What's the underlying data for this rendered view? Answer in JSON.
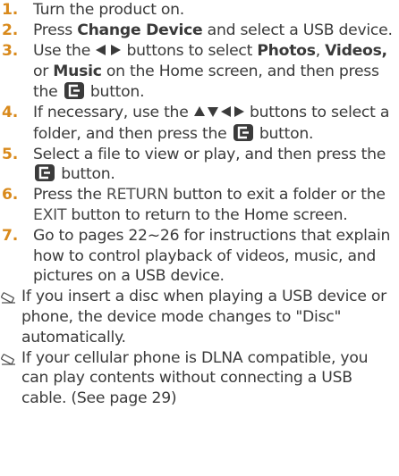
{
  "steps": [
    {
      "num": "1.",
      "text": "Turn the product on."
    },
    {
      "num": "2.",
      "a": "Press ",
      "b1": "Change Device",
      "c": " and select a USB device."
    },
    {
      "num": "3.",
      "a": "Use the ",
      "b": " buttons to select ",
      "p": "Photos",
      "sep1": ", ",
      "v": "Videos,",
      "sep2": " or ",
      "m": "Music",
      "c": " on the Home screen, and then press the ",
      "d": " button."
    },
    {
      "num": "4.",
      "a": "If necessary, use the ",
      "b": " buttons to select a folder, and then press the ",
      "c": " button."
    },
    {
      "num": "5.",
      "a": "Select a file to view or play, and then press the ",
      "b": " button."
    },
    {
      "num": "6.",
      "a": "Press the ",
      "ret": "RETURN",
      "b": " button to exit a folder or the ",
      "exit": "EXIT",
      "c": " button to return to the Home screen."
    },
    {
      "num": "7.",
      "text": "Go to pages 22~26 for instructions that explain how to control playback of videos, music, and pictures on a USB device."
    }
  ],
  "notes": [
    {
      "text": "If you insert a disc when playing a USB device or phone, the device mode changes to \"Disc\" automatically."
    },
    {
      "text": "If your cellular phone is DLNA compatible, you can play contents without connecting a USB cable. (See page 29)"
    }
  ],
  "icons": {
    "enter": "enter-button-icon",
    "lr": "left-right-arrows-icon",
    "udlr": "up-down-left-right-arrows-icon",
    "note": "note-pencil-icon"
  },
  "colors": {
    "number": "#d98a1c",
    "text": "#3a3a3a",
    "enter_bg": "#3b3b3b"
  }
}
